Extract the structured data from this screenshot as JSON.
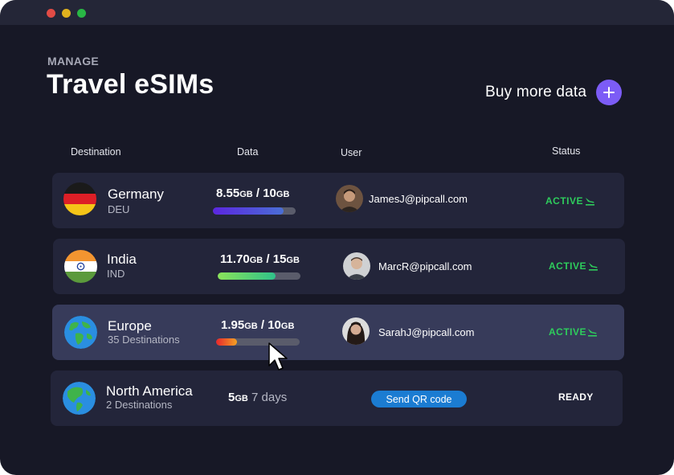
{
  "window": {
    "controls": [
      {
        "name": "close",
        "color": "#e14b45"
      },
      {
        "name": "minimize",
        "color": "#e0b21e"
      },
      {
        "name": "maximize",
        "color": "#29b745"
      }
    ]
  },
  "header": {
    "eyebrow": "MANAGE",
    "title": "Travel eSIMs",
    "buy_label": "Buy more data",
    "buy_icon": "plus-icon"
  },
  "columns": {
    "destination": "Destination",
    "data": "Data",
    "user": "User",
    "status": "Status"
  },
  "rows": [
    {
      "destination": "Germany",
      "code": "DEU",
      "flag": "germany-flag",
      "used": "8.55",
      "used_unit": "GB",
      "separator": " / ",
      "total": "10",
      "total_unit": "GB",
      "usage_fraction": 0.855,
      "bar_colors": [
        "#5b26e0",
        "#4a6fd6"
      ],
      "user_email": "JamesJ@pipcall.com",
      "status": "ACTIVE",
      "status_icon": "plane-landing-icon"
    },
    {
      "destination": "India",
      "code": "IND",
      "flag": "india-flag",
      "used": "11.70",
      "used_unit": "GB",
      "separator": " / ",
      "total": "15",
      "total_unit": "GB",
      "usage_fraction": 0.7,
      "bar_colors": [
        "#8ae35a",
        "#2fc28a"
      ],
      "user_email": "MarcR@pipcall.com",
      "status": "ACTIVE",
      "status_icon": "plane-landing-icon"
    },
    {
      "destination": "Europe",
      "code": "35 Destinations",
      "flag": "globe-icon",
      "used": "1.95",
      "used_unit": "GB",
      "separator": " / ",
      "total": "10",
      "total_unit": "GB",
      "usage_fraction": 0.25,
      "bar_colors": [
        "#e8262c",
        "#f4a224"
      ],
      "user_email": "SarahJ@pipcall.com",
      "status": "ACTIVE",
      "status_icon": "plane-landing-icon"
    },
    {
      "destination": "North America",
      "code": "2 Destinations",
      "flag": "globe-icon",
      "plan_amount": "5",
      "plan_unit": "GB",
      "plan_days": " 7 days",
      "action_label": "Send QR code",
      "status": "READY"
    }
  ],
  "colors": {
    "background": "#171826",
    "row": "#23253a",
    "row_highlight": "#373b5a",
    "accent": "#7c5cf6",
    "active_green": "#2ecc5c",
    "button_blue": "#1b7cd2"
  }
}
